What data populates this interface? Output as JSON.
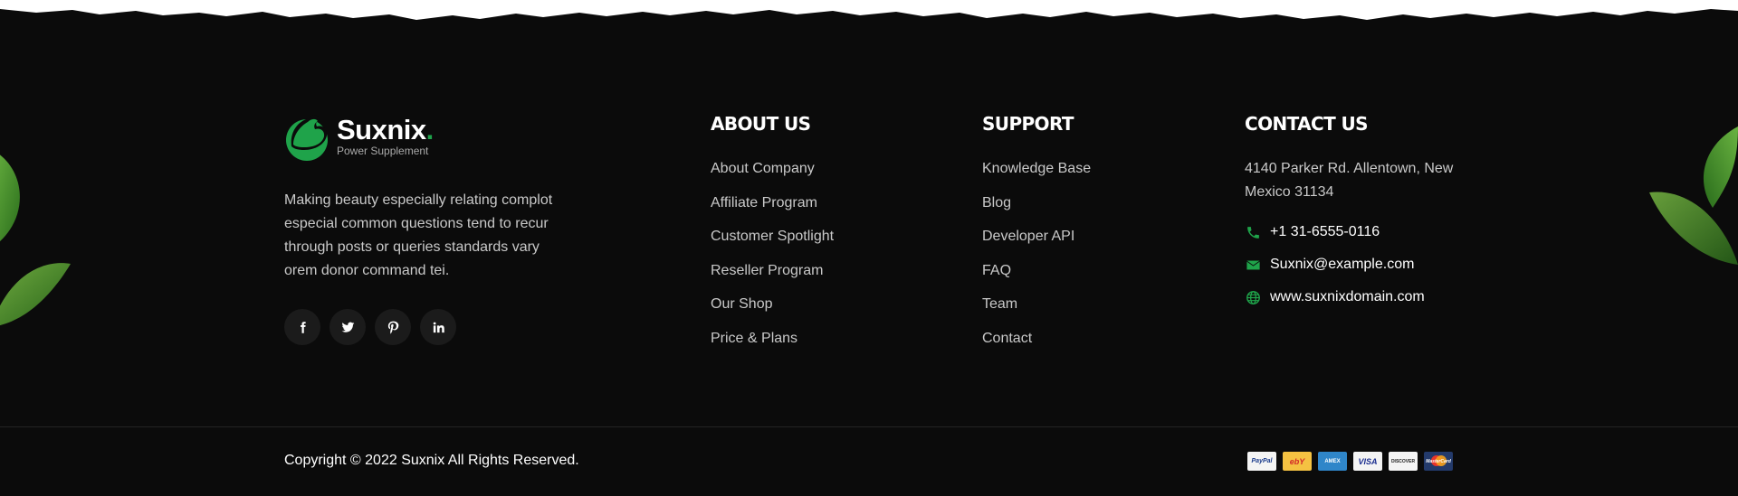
{
  "brand": {
    "name": "Suxnix",
    "dot": ".",
    "tagline": "Power Supplement",
    "about": "Making beauty especially relating complot especial common questions tend to recur through posts or queries standards vary orem donor command tei."
  },
  "socials": [
    {
      "icon": "facebook-icon"
    },
    {
      "icon": "twitter-icon"
    },
    {
      "icon": "pinterest-icon"
    },
    {
      "icon": "linkedin-icon"
    }
  ],
  "about_us": {
    "title": "ABOUT US",
    "links": [
      "About Company",
      "Affiliate Program",
      "Customer Spotlight",
      "Reseller Program",
      "Our Shop",
      "Price & Plans"
    ]
  },
  "support": {
    "title": "SUPPORT",
    "links": [
      "Knowledge Base",
      "Blog",
      "Developer API",
      "FAQ",
      "Team",
      "Contact"
    ]
  },
  "contact": {
    "title": "CONTACT US",
    "address": "4140 Parker Rd. Allentown, New Mexico 31134",
    "phone": "+1 31-6555-0116",
    "email": "Suxnix@example.com",
    "website": "www.suxnixdomain.com"
  },
  "copyright": "Copyright © 2022 Suxnix All Rights Reserved.",
  "payments": {
    "paypal": "PayPal",
    "ebay": "ebY",
    "amex": "AMEX",
    "visa": "VISA",
    "discover": "DISCOVER",
    "mastercard": "MasterCard"
  },
  "colors": {
    "accent": "#1fa34a",
    "background": "#0b0b0b",
    "muted_text": "#c9c9c9"
  }
}
